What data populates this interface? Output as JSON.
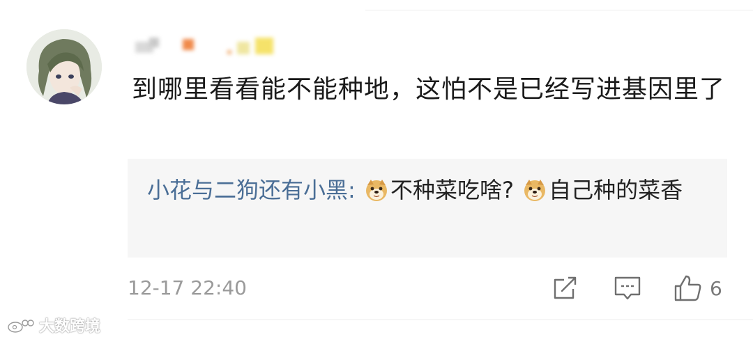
{
  "comment": {
    "text": "到哪里看看能不能种地，这怕不是已经写进基因里了",
    "timestamp": "12-17 22:40",
    "like_count": "6"
  },
  "reply": {
    "author": "小花与二狗还有小黑",
    "separator": ": ",
    "segment1": "不种菜吃啥? ",
    "segment2": "自己种的菜香",
    "emoji": "doge-emoji"
  },
  "actions": {
    "share_icon": "share-edit-icon",
    "reply_icon": "comment-icon",
    "like_icon": "thumbs-up-icon"
  },
  "watermark": {
    "text": "大数跨境",
    "icon": "weibo-logo-icon"
  },
  "colors": {
    "author_link": "#4a6e96",
    "reply_bg": "#f6f6f6",
    "meta_text": "#9a9a9a",
    "body_text": "#1a1a1a"
  }
}
